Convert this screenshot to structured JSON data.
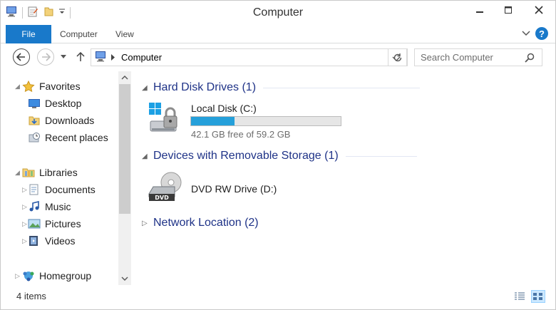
{
  "window": {
    "title": "Computer"
  },
  "ribbon": {
    "file_tab": "File",
    "tabs": [
      "Computer",
      "View"
    ],
    "help_label": "?"
  },
  "address": {
    "path": "Computer"
  },
  "search": {
    "placeholder": "Search Computer"
  },
  "nav": {
    "favorites": {
      "label": "Favorites",
      "items": [
        "Desktop",
        "Downloads",
        "Recent places"
      ]
    },
    "libraries": {
      "label": "Libraries",
      "items": [
        "Documents",
        "Music",
        "Pictures",
        "Videos"
      ]
    },
    "homegroup": {
      "label": "Homegroup"
    }
  },
  "content": {
    "groups": [
      {
        "title": "Hard Disk Drives (1)",
        "expanded": true
      },
      {
        "title": "Devices with Removable Storage (1)",
        "expanded": true
      },
      {
        "title": "Network Location (2)",
        "expanded": false
      }
    ],
    "local_disk": {
      "name": "Local Disk (C:)",
      "free_text": "42.1 GB free of 59.2 GB",
      "used_fraction": 0.289
    },
    "dvd": {
      "name": "DVD RW Drive (D:)",
      "label": "DVD"
    }
  },
  "status": {
    "items_text": "4 items"
  },
  "colors": {
    "accent": "#1979ca",
    "capacity_fill": "#26a0da",
    "group_header": "#1e3287"
  }
}
